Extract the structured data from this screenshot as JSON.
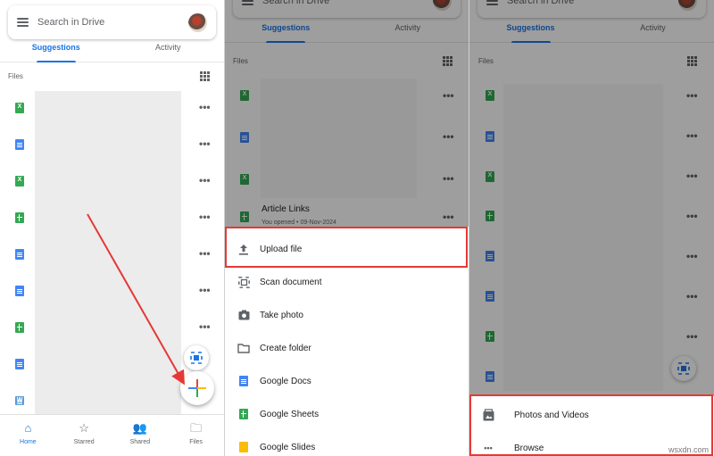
{
  "search": {
    "placeholder": "Search in Drive"
  },
  "tabs": [
    "Suggestions",
    "Activity"
  ],
  "files_header": "Files",
  "article_title": "Article Links",
  "article_meta": "You opened • 09-Nov-2024",
  "bottom_nav": [
    {
      "label": "Home",
      "icon": "home-icon",
      "active": true
    },
    {
      "label": "Starred",
      "icon": "star-icon",
      "active": false
    },
    {
      "label": "Shared",
      "icon": "shared-icon",
      "active": false
    },
    {
      "label": "Files",
      "icon": "folder-icon",
      "active": false
    }
  ],
  "new_menu": [
    {
      "label": "Upload file",
      "icon": "upload-icon"
    },
    {
      "label": "Scan document",
      "icon": "scan-icon"
    },
    {
      "label": "Take photo",
      "icon": "camera-icon"
    },
    {
      "label": "Create folder",
      "icon": "folder-icon"
    },
    {
      "label": "Google Docs",
      "icon": "google-docs-icon"
    },
    {
      "label": "Google Sheets",
      "icon": "google-sheets-icon"
    },
    {
      "label": "Google Slides",
      "icon": "google-slides-icon"
    }
  ],
  "upload_menu": [
    {
      "label": "Photos and Videos",
      "icon": "photos-icon"
    },
    {
      "label": "Browse",
      "icon": "more-horizontal-icon"
    }
  ],
  "watermark": "wsxdn.com",
  "colors": {
    "accent": "#1a73e8",
    "highlight": "#e53935",
    "sheets": "#34a853",
    "docs": "#4285f4"
  }
}
